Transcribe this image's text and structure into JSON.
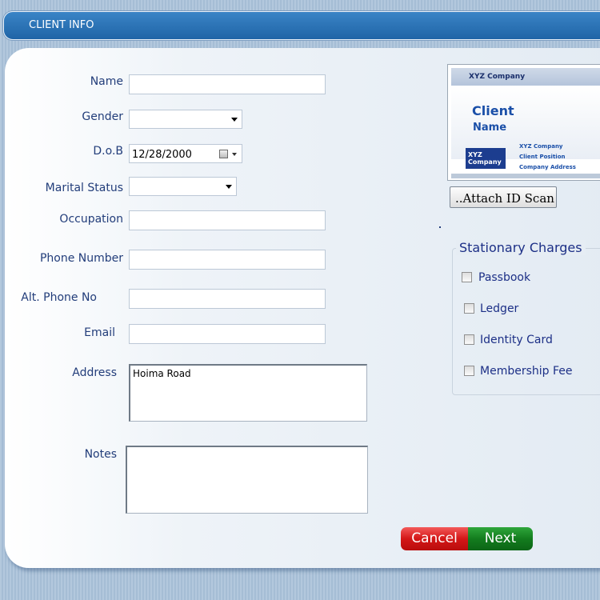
{
  "header": {
    "title": "CLIENT INFO"
  },
  "form": {
    "name_label": "Name",
    "gender_label": "Gender",
    "dob_label": "D.o.B",
    "dob_value": "12/28/2000",
    "marital_label": "Marital Status",
    "occupation_label": "Occupation",
    "phone_label": "Phone Number",
    "alt_phone_label": "Alt. Phone No",
    "email_label": "Email",
    "address_label": "Address",
    "address_value": "Hoima Road",
    "notes_label": "Notes"
  },
  "id_card": {
    "company": "XYZ Company",
    "client": "Client",
    "name": "Name",
    "logo_line1": "XYZ",
    "logo_line2": "Company",
    "info1": "XYZ Company",
    "info2": "Client Position",
    "info3": "Company Address"
  },
  "attach_button": "..Attach ID Scan",
  "stationary": {
    "title": "Stationary Charges",
    "items": [
      "Passbook",
      "Ledger",
      "Identity Card",
      "Membership Fee"
    ]
  },
  "buttons": {
    "cancel": "Cancel",
    "next": "Next"
  },
  "colors": {
    "header": "#2a73b7",
    "label": "#223d7a",
    "cancel": "#d41717",
    "next": "#137c1e"
  }
}
